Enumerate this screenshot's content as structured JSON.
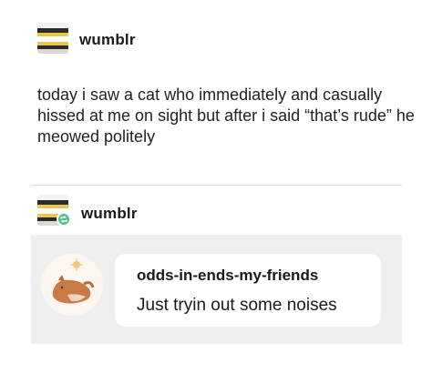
{
  "post1": {
    "username": "wumblr",
    "avatar_icon": "striped-blanket-avatar-icon",
    "body": "today i saw a cat who immediately and casually hissed at me on sight but after i said “that’s rude” he meowed politely"
  },
  "post2": {
    "username": "wumblr",
    "avatar_icon": "striped-blanket-avatar-icon",
    "badge_icon": "reblog-icon",
    "badge_color": "#56bc8a",
    "chat": {
      "avatar_icon": "sleeping-fox-avatar-icon",
      "sender": "odds-in-ends-my-friends",
      "message": "Just tryin out some noises"
    }
  }
}
